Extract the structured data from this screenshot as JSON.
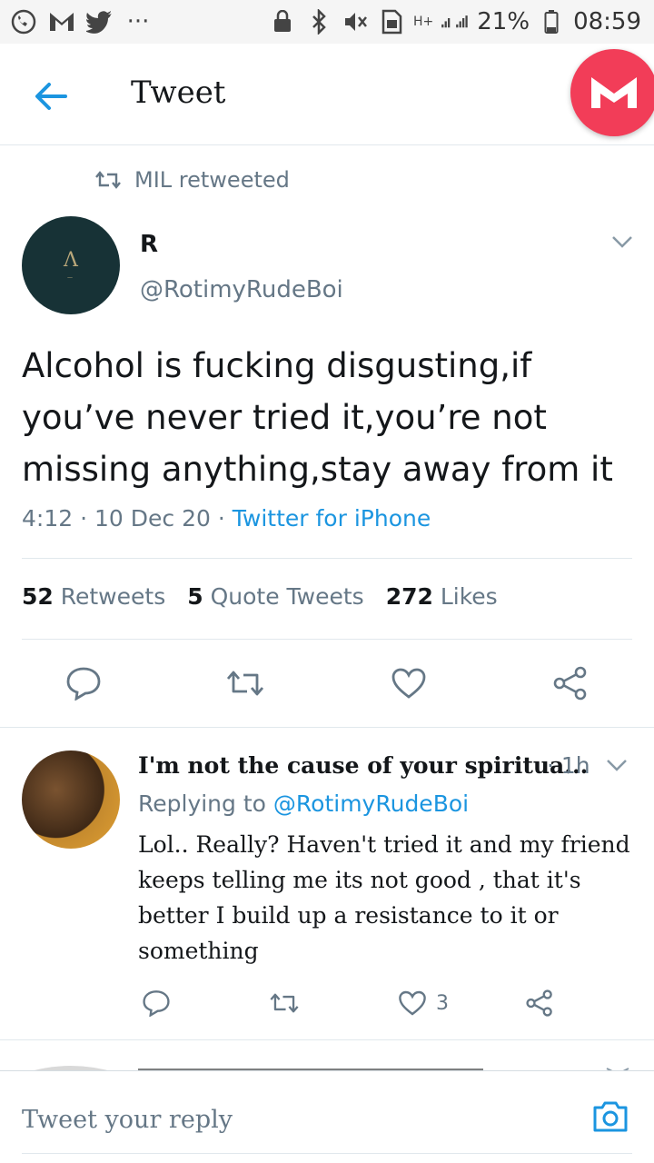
{
  "status_bar": {
    "battery": "21%",
    "time": "08:59",
    "network": "H+"
  },
  "header": {
    "title": "Tweet"
  },
  "retweet_context": {
    "label": "MIL retweeted"
  },
  "tweet": {
    "author_name": "R",
    "author_handle": "@RotimyRudeBoi",
    "text": "Alcohol is fucking disgusting,if you’ve never tried it,you’re not missing anything,stay away from it",
    "time": "4:12",
    "date": "10 Dec 20",
    "source": "Twitter for iPhone",
    "retweets_count": "52",
    "retweets_label": "Retweets",
    "quotes_count": "5",
    "quotes_label": "Quote Tweets",
    "likes_count": "272",
    "likes_label": "Likes"
  },
  "reply": {
    "name": "I'm not the cause of your spiritua...",
    "time": "1h",
    "replying_prefix": "Replying to",
    "replying_to": "@RotimyRudeBoi",
    "text": "Lol.. Really? Haven't tried it and my friend keeps telling me its not good , that it's better I build up a resistance to it or something",
    "likes": "3"
  },
  "composer": {
    "placeholder": "Tweet your reply"
  },
  "colors": {
    "accent": "#1b95e0",
    "secondary_text": "#657786",
    "divider": "#e1e8ed",
    "app_badge": "#f23d58"
  }
}
